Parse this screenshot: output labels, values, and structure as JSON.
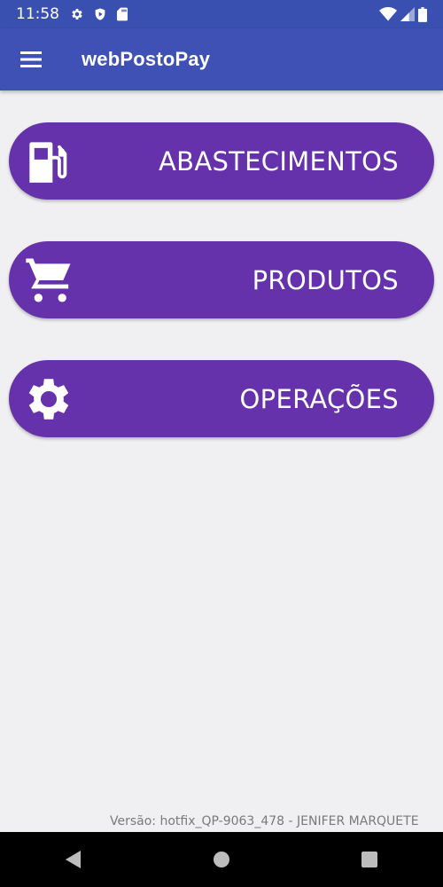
{
  "status_bar": {
    "time": "11:58",
    "icons_left": [
      "gear-icon",
      "shield-icon",
      "sd-card-icon"
    ],
    "icons_right": [
      "wifi-icon",
      "signal-icon",
      "battery-icon"
    ]
  },
  "app_bar": {
    "title": "webPostoPay",
    "menu_icon": "hamburger-menu-icon",
    "color": "#3f51b5"
  },
  "menu": {
    "button_color": "#6632ab",
    "items": [
      {
        "label": "ABASTECIMENTOS",
        "icon": "fuel-pump-icon"
      },
      {
        "label": "PRODUTOS",
        "icon": "shopping-cart-icon"
      },
      {
        "label": "OPERAÇÕES",
        "icon": "gear-icon"
      }
    ]
  },
  "footer": {
    "version": "Versão: hotfix_QP-9063_478 - JENIFER MARQUETE"
  },
  "nav_bar": {
    "buttons": [
      "back-icon",
      "home-icon",
      "recents-icon"
    ]
  }
}
